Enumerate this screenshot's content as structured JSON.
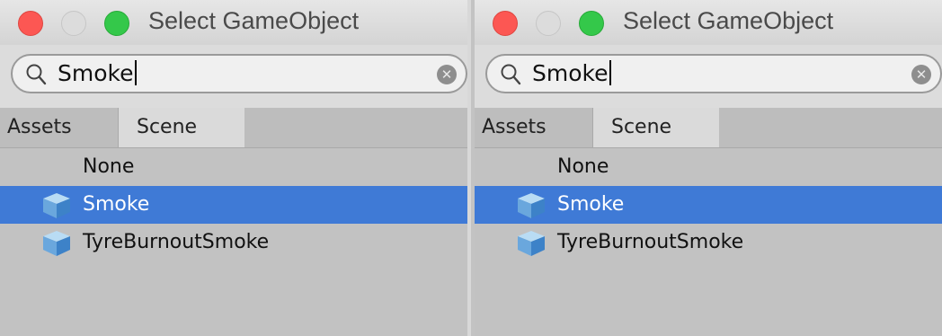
{
  "panels": [
    {
      "window_title": "Select GameObject",
      "search": {
        "value": "Smoke"
      },
      "tabs": [
        {
          "label": "Assets"
        },
        {
          "label": "Scene"
        }
      ],
      "active_tab": "Scene",
      "items": [
        {
          "label": "None",
          "icon": null,
          "selected": false
        },
        {
          "label": "Smoke",
          "icon": "gameobject-cube-icon",
          "selected": true
        },
        {
          "label": "TyreBurnoutSmoke",
          "icon": "gameobject-cube-icon",
          "selected": false
        }
      ]
    },
    {
      "window_title": "Select GameObject",
      "search": {
        "value": "Smoke"
      },
      "tabs": [
        {
          "label": "Assets"
        },
        {
          "label": "Scene"
        }
      ],
      "active_tab": "Scene",
      "items": [
        {
          "label": "None",
          "icon": null,
          "selected": false
        },
        {
          "label": "Smoke",
          "icon": "gameobject-cube-icon",
          "selected": true
        },
        {
          "label": "TyreBurnoutSmoke",
          "icon": "gameobject-cube-icon",
          "selected": false
        }
      ]
    }
  ],
  "colors": {
    "selection": "#3f7ad6",
    "close_button": "#fc5753",
    "maximize_button": "#34c84a"
  }
}
